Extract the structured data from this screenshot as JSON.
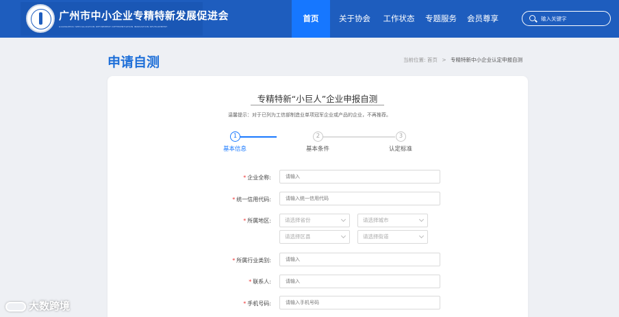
{
  "header": {
    "logo_title": "广州市中小企业专精特新发展促进会",
    "logo_subtitle": "GUANGZHOU SPECIALIZATION REFINEMENT DIFFERENTIATION INNOVATION DEVELOPMENT",
    "nav": [
      "首页",
      "关于协会",
      "工作状态",
      "专题服务",
      "会员尊享"
    ],
    "active_nav": "首页",
    "search_placeholder": "输入关键字"
  },
  "page": {
    "title": "申请自测",
    "breadcrumb_prefix": "当前位置:",
    "breadcrumb_home": "首页",
    "breadcrumb_sep": ">",
    "breadcrumb_current": "专精特新中小企业认定申报自测"
  },
  "form": {
    "title": "专精特新“小巨人”企业申报自测",
    "hint": "温馨提示：对于已列为工信部制造业单项冠军企业或产品的企业，不再推荐。",
    "steps": [
      {
        "num": "1",
        "label": "基本信息"
      },
      {
        "num": "2",
        "label": "基本条件"
      },
      {
        "num": "3",
        "label": "认定标准"
      }
    ],
    "active_step": 1,
    "required_mark": "*",
    "fields": {
      "company_name": {
        "label": "企业全称:",
        "placeholder": "请输入"
      },
      "credit_code": {
        "label": "统一信用代码:",
        "placeholder": "请输入统一信用代码"
      },
      "region": {
        "label": "所属地区:",
        "province": "请选择省份",
        "city": "请选择城市",
        "district": "请选择区县",
        "street": "请选择街道"
      },
      "industry": {
        "label": "所属行业类别:",
        "placeholder": "请输入"
      },
      "contact": {
        "label": "联系人:",
        "placeholder": "请输入"
      },
      "phone": {
        "label": "手机号码:",
        "placeholder": "请输入手机号码"
      }
    }
  },
  "watermark": {
    "text": "大数跨境"
  },
  "colors": {
    "header_bg": "#1e5dbe",
    "accent": "#1677ff",
    "title_blue": "#1e6fd8",
    "required": "#e33333"
  }
}
